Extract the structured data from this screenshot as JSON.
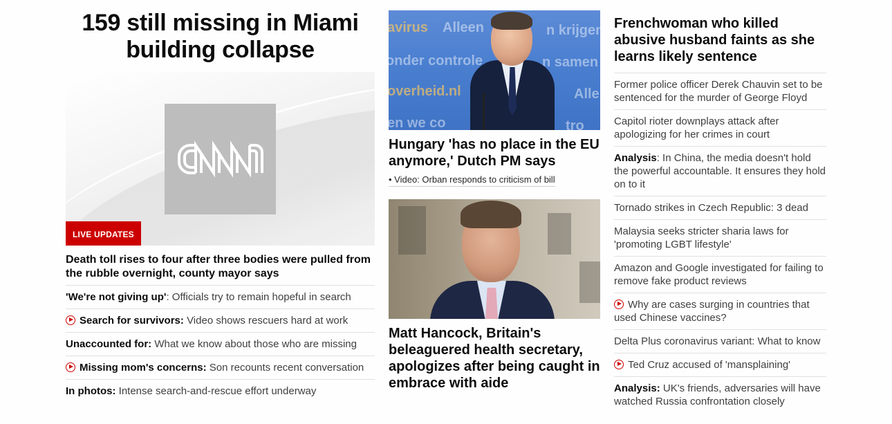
{
  "column1": {
    "headline": "159 still missing in Miami building collapse",
    "image": {
      "logo_text": "CNN"
    },
    "badge": "LIVE UPDATES",
    "lead": "Death toll rises to four after three bodies were pulled from the rubble overnight, county mayor says",
    "items": [
      {
        "bold": "'We're not giving up'",
        "text": ": Officials try to remain hopeful in search",
        "video": false
      },
      {
        "bold": "Search for survivors:",
        "text": " Video shows rescuers hard at work",
        "video": true
      },
      {
        "bold": "Unaccounted for:",
        "text": " What we know about those who are missing",
        "video": false
      },
      {
        "bold": "Missing mom's concerns:",
        "text": " Son recounts recent conversation",
        "video": true
      },
      {
        "bold": "In photos:",
        "text": " Intense search-and-rescue effort underway",
        "video": false
      }
    ]
  },
  "column2": {
    "story1": {
      "headline": "Hungary 'has no place in the EU anymore,' Dutch PM says",
      "sub_link": "• Video: Orban responds to criticism of bill",
      "image_bg_text": [
        "avirus",
        "Alleen",
        "n krijgen",
        "onder controle",
        "n samen",
        "overheid.nl",
        "Alle",
        "en we co",
        "tro"
      ]
    },
    "story2": {
      "headline": "Matt Hancock, Britain's beleaguered health secretary, apologizes after being caught in embrace with aide"
    }
  },
  "column3": {
    "headline": "Frenchwoman who killed abusive husband faints as she learns likely sentence",
    "items": [
      {
        "bold": "",
        "text": "Former police officer Derek Chauvin set to be sentenced for the murder of George Floyd",
        "video": false
      },
      {
        "bold": "",
        "text": "Capitol rioter downplays attack after apologizing for her crimes in court",
        "video": false
      },
      {
        "bold": "Analysis",
        "text": ": In China, the media doesn't hold the powerful accountable. It ensures they hold on to it",
        "video": false
      },
      {
        "bold": "",
        "text": "Tornado strikes in Czech Republic: 3 dead",
        "video": false
      },
      {
        "bold": "",
        "text": "Malaysia seeks stricter sharia laws for 'promoting LGBT lifestyle'",
        "video": false
      },
      {
        "bold": "",
        "text": "Amazon and Google investigated for failing to remove fake product reviews",
        "video": false
      },
      {
        "bold": "",
        "text": "Why are cases surging in countries that used Chinese vaccines?",
        "video": true
      },
      {
        "bold": "",
        "text": "Delta Plus coronavirus variant: What to know",
        "video": false
      },
      {
        "bold": "",
        "text": "Ted Cruz accused of 'mansplaining'",
        "video": true
      },
      {
        "bold": "Analysis:",
        "text": " UK's friends, adversaries will have watched Russia confrontation closely",
        "video": false
      }
    ]
  },
  "colors": {
    "accent_red": "#cc0000",
    "text_dark": "#0c0c0c",
    "text_body": "#404040",
    "divider": "#e1e1e1"
  }
}
